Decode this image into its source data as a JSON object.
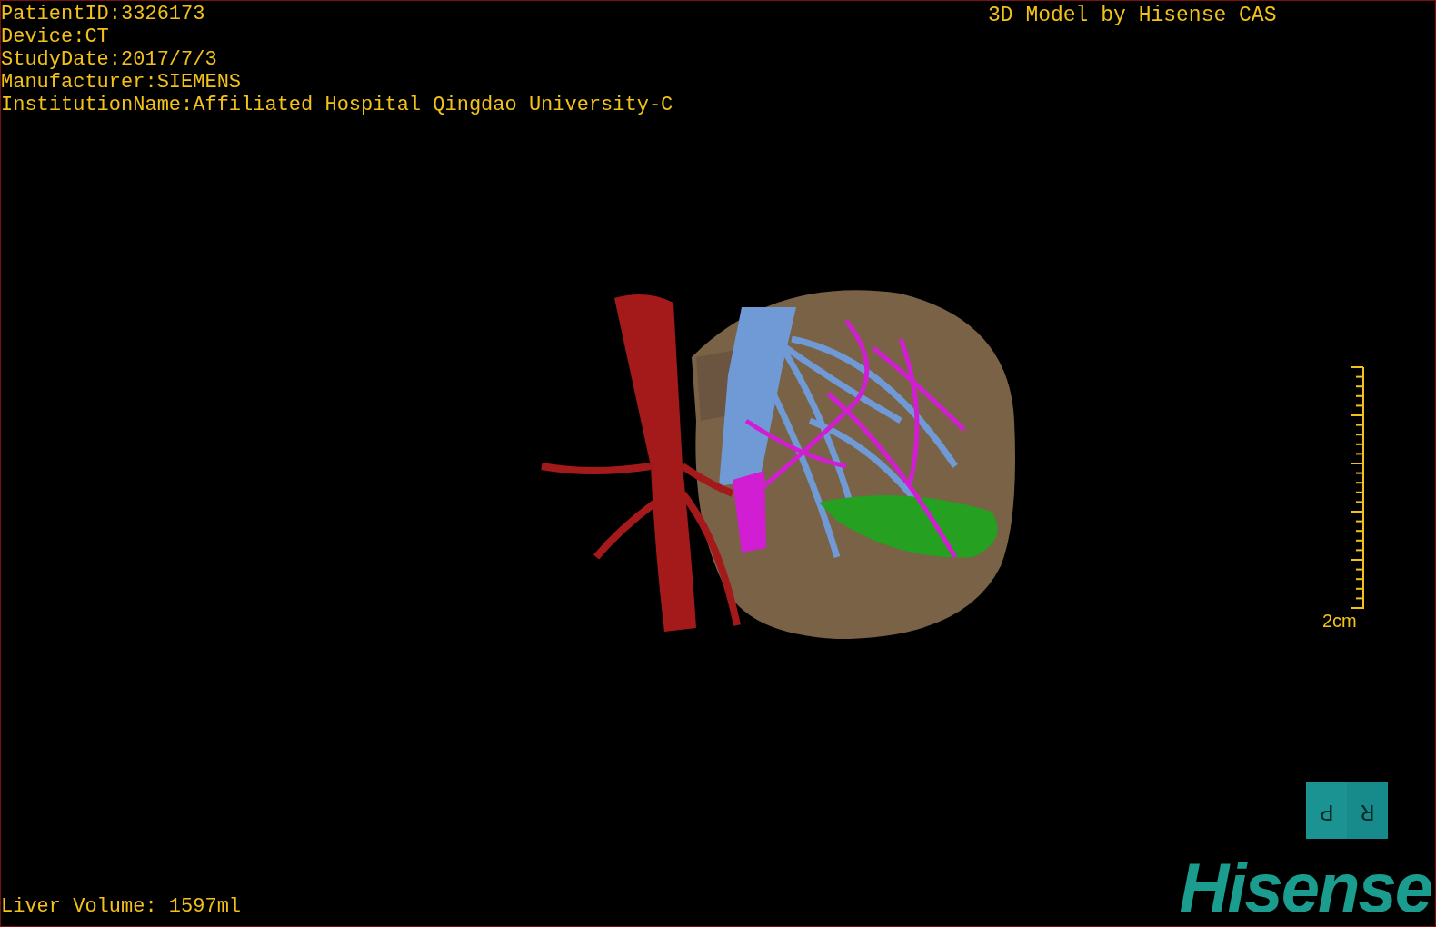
{
  "patient_info": [
    "PatientID:3326173",
    "Device:CT",
    "StudyDate:2017/7/3",
    "Manufacturer:SIEMENS",
    "InstitutionName:Affiliated Hospital Qingdao University-C"
  ],
  "caption": "3D Model by Hisense CAS",
  "scale_bar": {
    "label": "2cm"
  },
  "orientation_cube": {
    "faces": [
      "P",
      "R"
    ]
  },
  "liver_volume": "Liver Volume: 1597ml",
  "logo": "Hisense"
}
